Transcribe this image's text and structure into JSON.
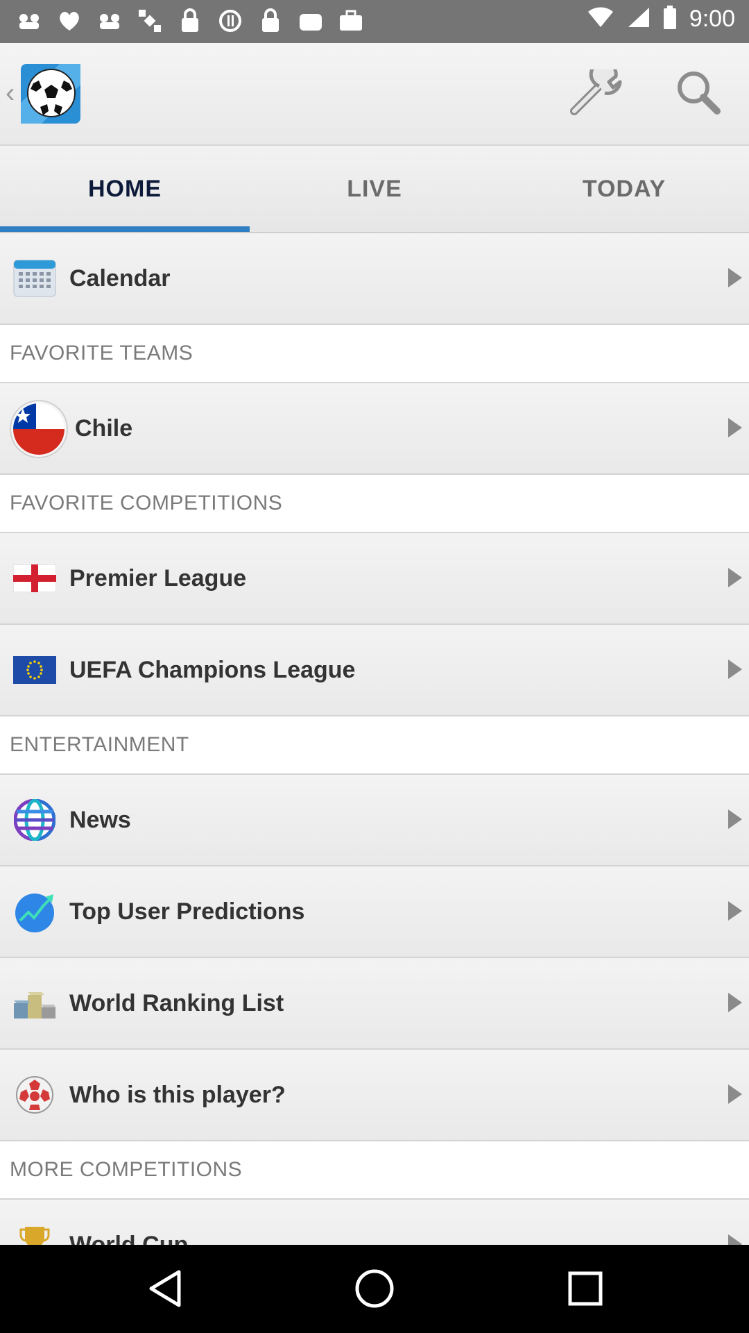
{
  "status_bar": {
    "time": "9:00",
    "left_icons": [
      "notification-icon",
      "heart-icon",
      "message-icon",
      "satellite-icon",
      "lock-icon",
      "blocked-icon",
      "lock-icon",
      "android-icon",
      "briefcase-icon"
    ],
    "right_icons": [
      "wifi-icon",
      "signal-icon",
      "battery-icon"
    ]
  },
  "app_bar": {
    "back_glyph": "‹",
    "logo_icon": "soccer-ball-icon",
    "actions": [
      "wrench-icon",
      "search-icon"
    ]
  },
  "tabs": [
    {
      "label": "HOME",
      "active": true
    },
    {
      "label": "LIVE",
      "active": false
    },
    {
      "label": "TODAY",
      "active": false
    }
  ],
  "calendar": {
    "label": "Calendar",
    "icon": "calendar-icon"
  },
  "sections": {
    "favorite_teams": {
      "title": "FAVORITE TEAMS",
      "items": [
        {
          "label": "Chile",
          "icon": "chile-flag-icon"
        }
      ]
    },
    "favorite_competitions": {
      "title": "FAVORITE COMPETITIONS",
      "items": [
        {
          "label": "Premier League",
          "icon": "england-flag-icon"
        },
        {
          "label": "UEFA Champions League",
          "icon": "eu-flag-icon"
        }
      ]
    },
    "entertainment": {
      "title": "ENTERTAINMENT",
      "items": [
        {
          "label": "News",
          "icon": "globe-icon"
        },
        {
          "label": "Top User Predictions",
          "icon": "trend-chart-icon"
        },
        {
          "label": "World Ranking List",
          "icon": "podium-icon"
        },
        {
          "label": "Who is this player?",
          "icon": "question-ball-icon"
        }
      ]
    },
    "more_competitions": {
      "title": "MORE COMPETITIONS",
      "items": [
        {
          "label": "World Cup",
          "icon": "trophy-icon"
        }
      ]
    }
  },
  "colors": {
    "accent": "#2f7fc2",
    "tab_active_text": "#0d1a3a",
    "nav_bar": "#000000",
    "status_bar": "#757575"
  }
}
